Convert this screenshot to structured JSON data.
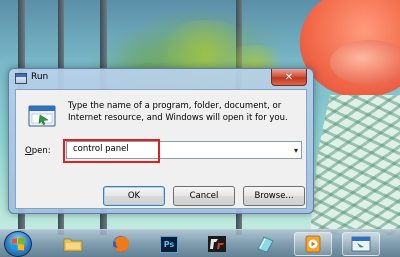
{
  "dialog": {
    "title": "Run",
    "close_glyph": "✕",
    "description": "Type the name of a program, folder, document, or Internet resource, and Windows will open it for you.",
    "open_label_accel": "O",
    "open_label_rest": "pen:",
    "input_value": "control panel",
    "dropdown_arrow": "▾",
    "buttons": {
      "ok": "OK",
      "cancel": "Cancel",
      "browse": "Browse..."
    }
  },
  "taskbar": {
    "items": [
      {
        "icon": "windows-start-icon"
      },
      {
        "icon": "file-explorer-icon"
      },
      {
        "icon": "firefox-icon"
      },
      {
        "icon": "photoshop-icon",
        "label": "Ps"
      },
      {
        "icon": "crossfire-icon"
      },
      {
        "icon": "notepad-icon"
      },
      {
        "icon": "media-player-icon"
      },
      {
        "icon": "run-window-icon"
      }
    ]
  },
  "colors": {
    "highlight": "#e0201c",
    "dialog_frame": "#b9d1ea",
    "taskbar": "#7896aa"
  }
}
